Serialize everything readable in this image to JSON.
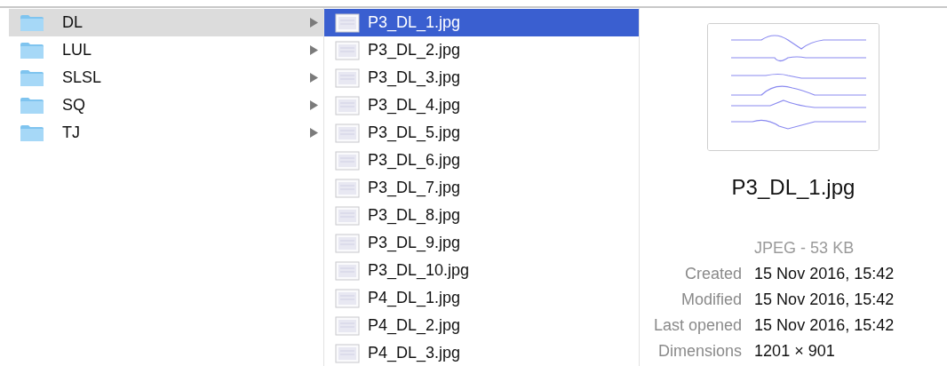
{
  "folders": [
    {
      "name": "DL",
      "selected": true
    },
    {
      "name": "LUL",
      "selected": false
    },
    {
      "name": "SLSL",
      "selected": false
    },
    {
      "name": "SQ",
      "selected": false
    },
    {
      "name": "TJ",
      "selected": false
    }
  ],
  "files": [
    {
      "name": "P3_DL_1.jpg",
      "selected": true
    },
    {
      "name": "P3_DL_2.jpg",
      "selected": false
    },
    {
      "name": "P3_DL_3.jpg",
      "selected": false
    },
    {
      "name": "P3_DL_4.jpg",
      "selected": false
    },
    {
      "name": "P3_DL_5.jpg",
      "selected": false
    },
    {
      "name": "P3_DL_6.jpg",
      "selected": false
    },
    {
      "name": "P3_DL_7.jpg",
      "selected": false
    },
    {
      "name": "P3_DL_8.jpg",
      "selected": false
    },
    {
      "name": "P3_DL_9.jpg",
      "selected": false
    },
    {
      "name": "P3_DL_10.jpg",
      "selected": false
    },
    {
      "name": "P4_DL_1.jpg",
      "selected": false
    },
    {
      "name": "P4_DL_2.jpg",
      "selected": false
    },
    {
      "name": "P4_DL_3.jpg",
      "selected": false
    }
  ],
  "preview": {
    "filename": "P3_DL_1.jpg",
    "kind_size": "JPEG - 53 KB",
    "info": [
      {
        "label": "Created",
        "value": "15 Nov 2016, 15:42"
      },
      {
        "label": "Modified",
        "value": "15 Nov 2016, 15:42"
      },
      {
        "label": "Last opened",
        "value": "15 Nov 2016, 15:42"
      },
      {
        "label": "Dimensions",
        "value": "1201 × 901"
      }
    ]
  }
}
